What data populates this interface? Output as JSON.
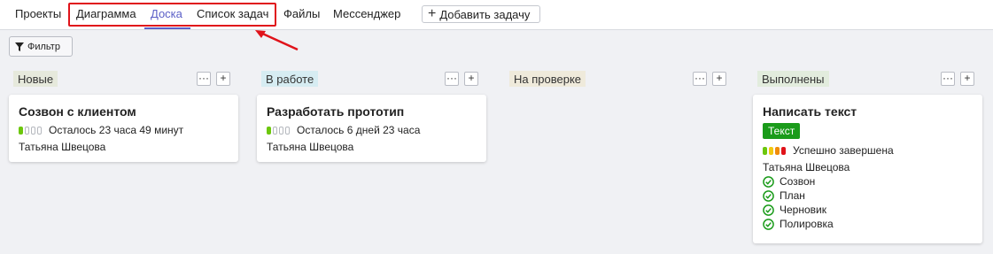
{
  "nav": {
    "tabs": [
      "Проекты",
      "Диаграмма",
      "Доска",
      "Список задач",
      "Файлы",
      "Мессенджер"
    ],
    "active_tab": "Доска",
    "add_task_label": "Добавить задачу"
  },
  "toolbar": {
    "filter_label": "Фильтр"
  },
  "columns": [
    {
      "title": "Новые",
      "header_color": "#e6e9dc"
    },
    {
      "title": "В работе",
      "header_color": "#d6ecf2"
    },
    {
      "title": "На проверке",
      "header_color": "#efeadb"
    },
    {
      "title": "Выполнены",
      "header_color": "#e2ecdd"
    }
  ],
  "cards": {
    "new_card": {
      "title": "Созвон с клиентом",
      "status": "Осталось 23 часа 49 минут",
      "assignee": "Татьяна Швецова"
    },
    "progress_card": {
      "title": "Разработать прототип",
      "status": "Осталось 6 дней 23 часа",
      "assignee": "Татьяна Швецова"
    },
    "done_card": {
      "title": "Написать текст",
      "tag": "Текст",
      "status": "Успешно завершена",
      "assignee": "Татьяна Швецова",
      "checklist": [
        "Созвон",
        "План",
        "Черновик",
        "Полировка"
      ]
    }
  },
  "colors": {
    "accent": "#5b5fc7",
    "highlight": "#e0131a",
    "tag_green": "#1a9b1a"
  },
  "icons": {
    "filter": "funnel-icon",
    "more": "ellipsis-icon",
    "add": "plus-icon",
    "check": "check-circle-icon"
  }
}
